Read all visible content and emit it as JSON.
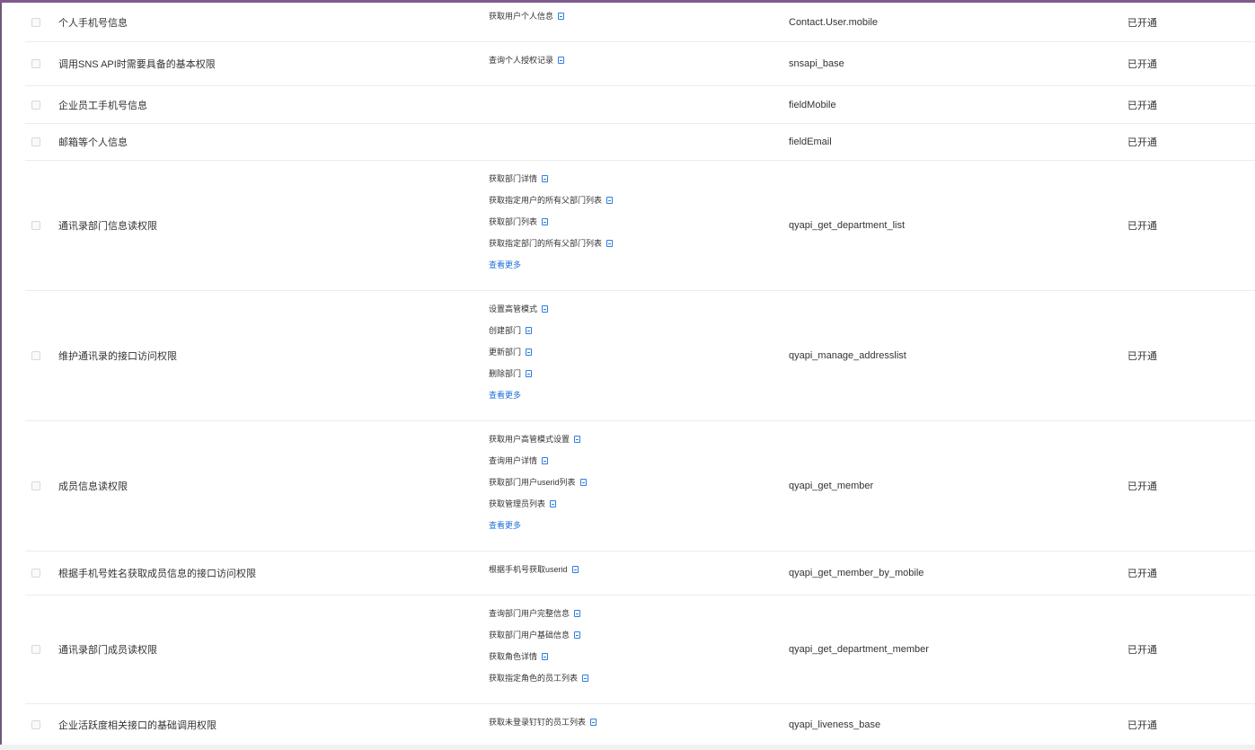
{
  "rows": [
    {
      "name": "个人手机号信息",
      "apis": [
        "获取用户个人信息"
      ],
      "more": "",
      "code": "Contact.User.mobile",
      "status": "已开通"
    },
    {
      "name": "调用SNS API时需要具备的基本权限",
      "apis": [
        "查询个人授权记录"
      ],
      "more": "",
      "code": "snsapi_base",
      "status": "已开通"
    },
    {
      "name": "企业员工手机号信息",
      "apis": [],
      "more": "",
      "code": "fieldMobile",
      "status": "已开通"
    },
    {
      "name": "邮箱等个人信息",
      "apis": [],
      "more": "",
      "code": "fieldEmail",
      "status": "已开通"
    },
    {
      "name": "通讯录部门信息读权限",
      "apis": [
        "获取部门详情",
        "获取指定用户的所有父部门列表",
        "获取部门列表",
        "获取指定部门的所有父部门列表"
      ],
      "more": "查看更多",
      "code": "qyapi_get_department_list",
      "status": "已开通"
    },
    {
      "name": "维护通讯录的接口访问权限",
      "apis": [
        "设置高管模式",
        "创建部门",
        "更新部门",
        "删除部门"
      ],
      "more": "查看更多",
      "code": "qyapi_manage_addresslist",
      "status": "已开通"
    },
    {
      "name": "成员信息读权限",
      "apis": [
        "获取用户高管模式设置",
        "查询用户详情",
        "获取部门用户userid列表",
        "获取管理员列表"
      ],
      "more": "查看更多",
      "code": "qyapi_get_member",
      "status": "已开通"
    },
    {
      "name": "根据手机号姓名获取成员信息的接口访问权限",
      "apis": [
        "根据手机号获取userid"
      ],
      "more": "",
      "code": "qyapi_get_member_by_mobile",
      "status": "已开通"
    },
    {
      "name": "通讯录部门成员读权限",
      "apis": [
        "查询部门用户完整信息",
        "获取部门用户基础信息",
        "获取角色详情",
        "获取指定角色的员工列表"
      ],
      "more": "",
      "code": "qyapi_get_department_member",
      "status": "已开通"
    },
    {
      "name": "企业活跃度相关接口的基础调用权限",
      "apis": [
        "获取未登录钉钉的员工列表"
      ],
      "more": "",
      "code": "qyapi_liveness_base",
      "status": "已开通"
    }
  ]
}
